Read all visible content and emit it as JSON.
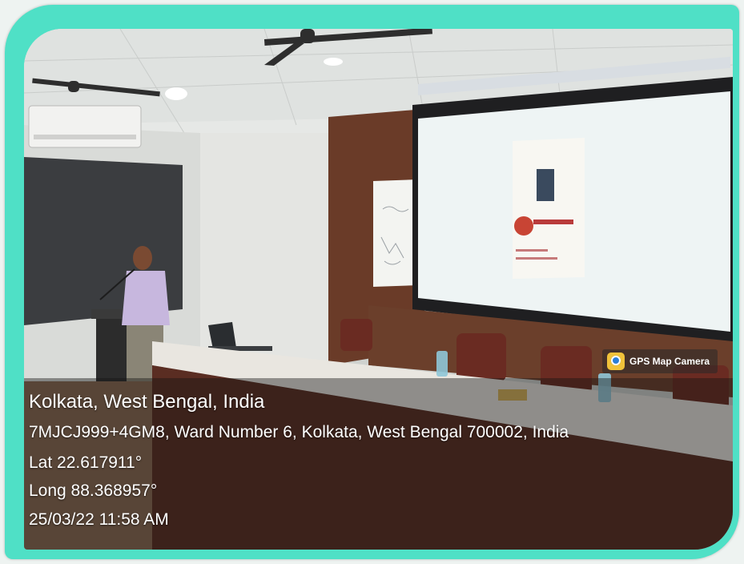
{
  "badge": {
    "label": "GPS Map Camera",
    "icon": "map-pin-icon"
  },
  "location": {
    "title": "Kolkata, West Bengal, India",
    "address": "7MJCJ999+4GM8, Ward Number 6, Kolkata, West Bengal 700002, India",
    "latitude": "Lat 22.617911°",
    "longitude": "Long 88.368957°",
    "datetime": "25/03/22 11:58 AM"
  },
  "colors": {
    "frame": "#4fe0c6",
    "badge_icon": "#f0c23a"
  }
}
